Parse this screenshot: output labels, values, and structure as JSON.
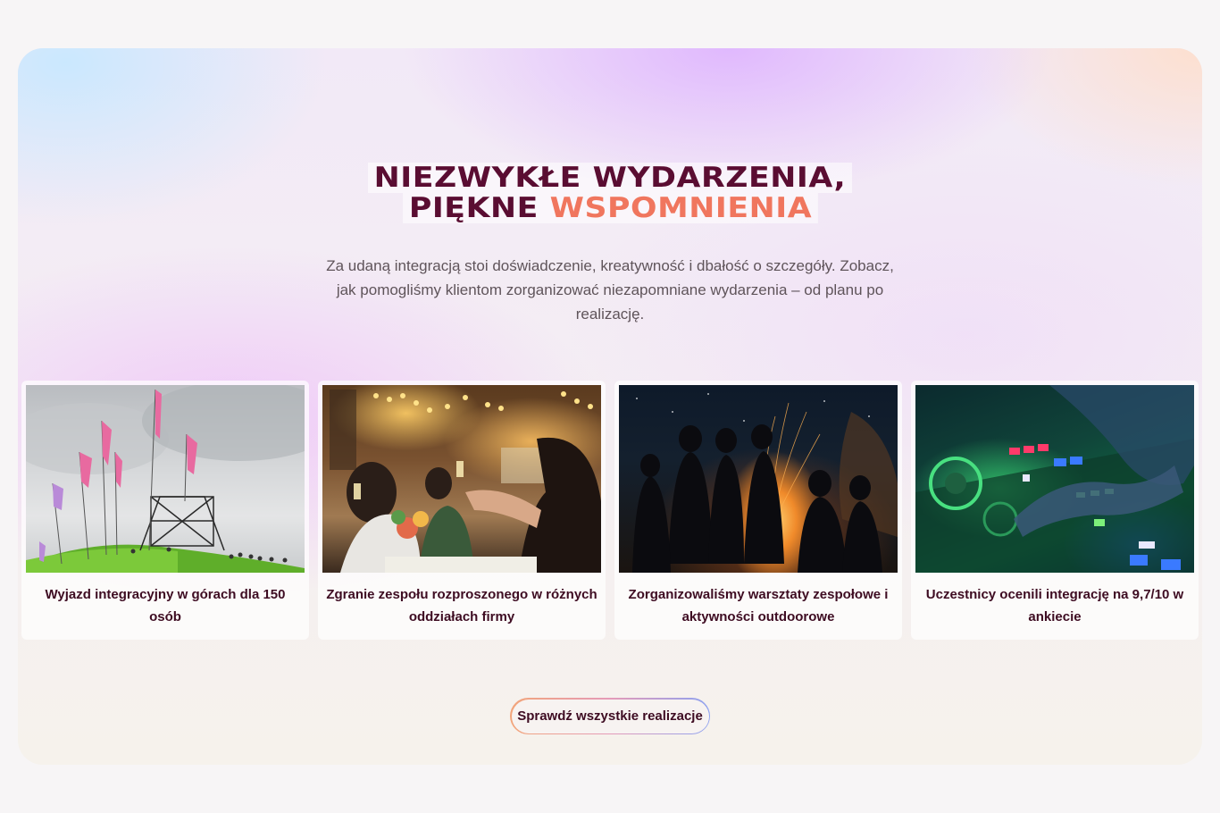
{
  "section": {
    "heading_line1": "NIEZWYKŁE WYDARZENIA,",
    "heading_line2_plain": "PIĘKNE",
    "heading_line2_accent": "WSPOMNIENIA",
    "lead": "Za udaną integracją stoi doświadczenie, kreatywność i dbałość o szczegóły. Zobacz, jak pomogliśmy klientom zorganizować niezapomniane wydarzenia – od planu po realizację."
  },
  "cards": [
    {
      "title": "Wyjazd integracyjny w górach dla 150 osób"
    },
    {
      "title": "Zgranie zespołu rozproszonego w różnych oddziałach firmy"
    },
    {
      "title": "Zorganizowaliśmy warsztaty zespołowe i aktywności outdoorowe"
    },
    {
      "title": "Uczestnicy ocenili integrację na 9,7/10 w ankiecie"
    }
  ],
  "cta": {
    "label": "Sprawdź wszystkie realizacje"
  },
  "colors": {
    "heading": "#5a0d32",
    "accent": "#f0765e",
    "text": "#5f545a"
  }
}
